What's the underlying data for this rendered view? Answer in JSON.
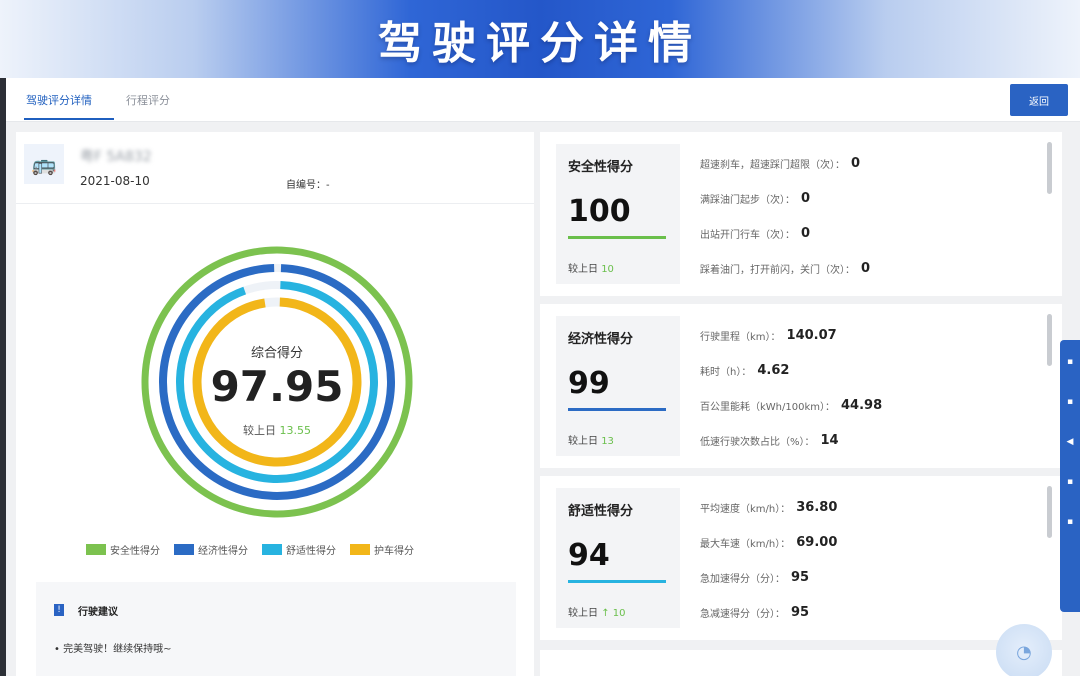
{
  "banner": {
    "title": "驾驶评分详情"
  },
  "tabs": [
    {
      "label": "驾驶评分详情",
      "active": true
    },
    {
      "label": "行程评分",
      "active": false
    }
  ],
  "back_button": {
    "label": "返回"
  },
  "vehicle": {
    "plate": "粤F 5A832",
    "date": "2021-08-10",
    "trip_no_label": "自编号：-",
    "icon": "bus-icon"
  },
  "overall": {
    "label": "综合得分",
    "value": "97.95",
    "compare_label": "较上日",
    "compare_value": "13.55"
  },
  "rings": [
    {
      "name": "安全性得分",
      "color": "#7cc24f",
      "value": 100
    },
    {
      "name": "经济性得分",
      "color": "#2b6bc4",
      "value": 99
    },
    {
      "name": "舒适性得分",
      "color": "#27b3e0",
      "value": 94
    },
    {
      "name": "护车得分",
      "color": "#f2b619",
      "value": 97
    }
  ],
  "legend": [
    {
      "label": "安全性得分",
      "color": "#7cc24f"
    },
    {
      "label": "经济性得分",
      "color": "#2b6bc4"
    },
    {
      "label": "舒适性得分",
      "color": "#27b3e0"
    },
    {
      "label": "护车得分",
      "color": "#f2b619"
    }
  ],
  "advice": {
    "title": "行驶建议",
    "text": "• 完美驾驶！继续保持哦~"
  },
  "categories": [
    {
      "title": "安全性得分",
      "score": "100",
      "bar_color": "#6abf4b",
      "compare_label": "较上日",
      "compare_value": "10",
      "metrics": [
        {
          "label": "超速刹车，超速踩门超限（次）：",
          "value": "0"
        },
        {
          "label": "满踩油门起步（次）：",
          "value": "0"
        },
        {
          "label": "出站开门行车（次）：",
          "value": "0"
        },
        {
          "label": "踩着油门，打开前闪，关门（次）：",
          "value": "0"
        }
      ]
    },
    {
      "title": "经济性得分",
      "score": "99",
      "bar_color": "#2b6bc4",
      "compare_label": "较上日",
      "compare_value": "13",
      "metrics": [
        {
          "label": "行驶里程（km）：",
          "value": "140.07"
        },
        {
          "label": "耗时（h）：",
          "value": "4.62"
        },
        {
          "label": "百公里能耗（kWh/100km）：",
          "value": "44.98"
        },
        {
          "label": "低速行驶次数占比（%）：",
          "value": "14"
        }
      ]
    },
    {
      "title": "舒适性得分",
      "score": "94",
      "bar_color": "#27b3e0",
      "compare_label": "较上日",
      "compare_value": "↑ 10",
      "metrics": [
        {
          "label": "平均速度（km/h）：",
          "value": "36.80"
        },
        {
          "label": "最大车速（km/h）：",
          "value": "69.00"
        },
        {
          "label": "急加速得分（分）：",
          "value": "95"
        },
        {
          "label": "急减速得分（分）：",
          "value": "95"
        }
      ]
    }
  ]
}
